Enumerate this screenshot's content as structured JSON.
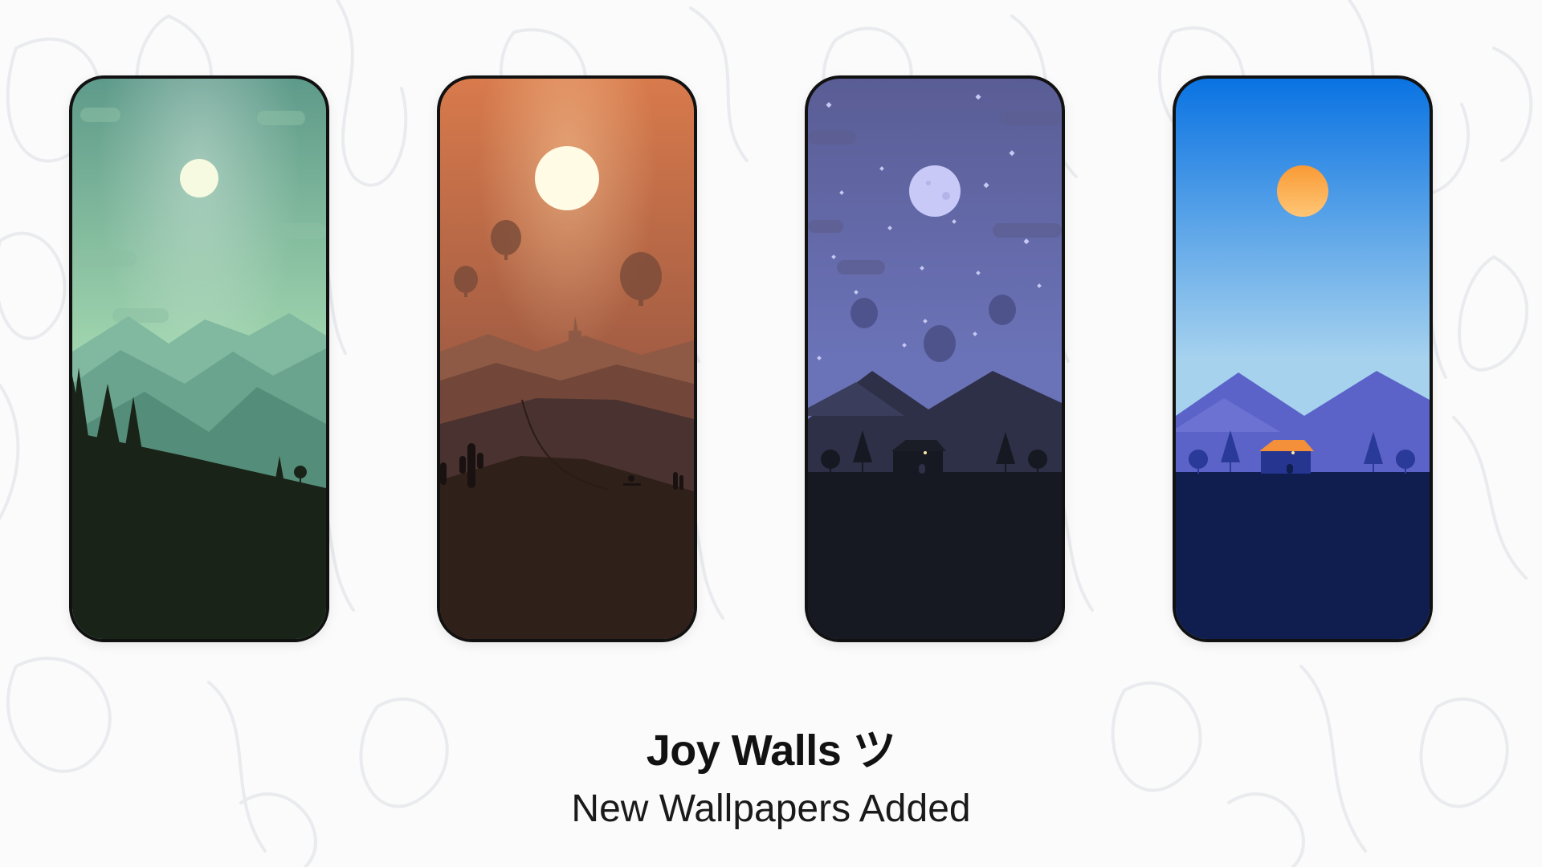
{
  "header": {
    "title": "Joy Walls ツ",
    "subtitle": "New Wallpapers Added"
  },
  "wallpapers": [
    {
      "theme": "green-alpine-sledding",
      "sky_top": "#5e9a8a",
      "sky_bottom": "#a8dcb2",
      "sun": "#f5fae0",
      "ground": "#1a2318"
    },
    {
      "theme": "orange-desert-balloons",
      "sky_top": "#d87a4c",
      "sky_bottom": "#a35d43",
      "sun": "#fffbe5",
      "ground": "#2f2019"
    },
    {
      "theme": "purple-night-moon-house",
      "sky_top": "#5a5d95",
      "sky_bottom": "#6b73b8",
      "sun": "#c8c9f7",
      "ground": "#161922"
    },
    {
      "theme": "blue-day-house",
      "sky_top": "#0a73e2",
      "sky_bottom": "#a6d2ee",
      "sun": "#f99a35",
      "ground": "#0f1d4f"
    }
  ],
  "colors": {
    "background": "#fbfbfb",
    "pattern_stroke": "#e9ebee",
    "phone_frame": "#111111"
  }
}
